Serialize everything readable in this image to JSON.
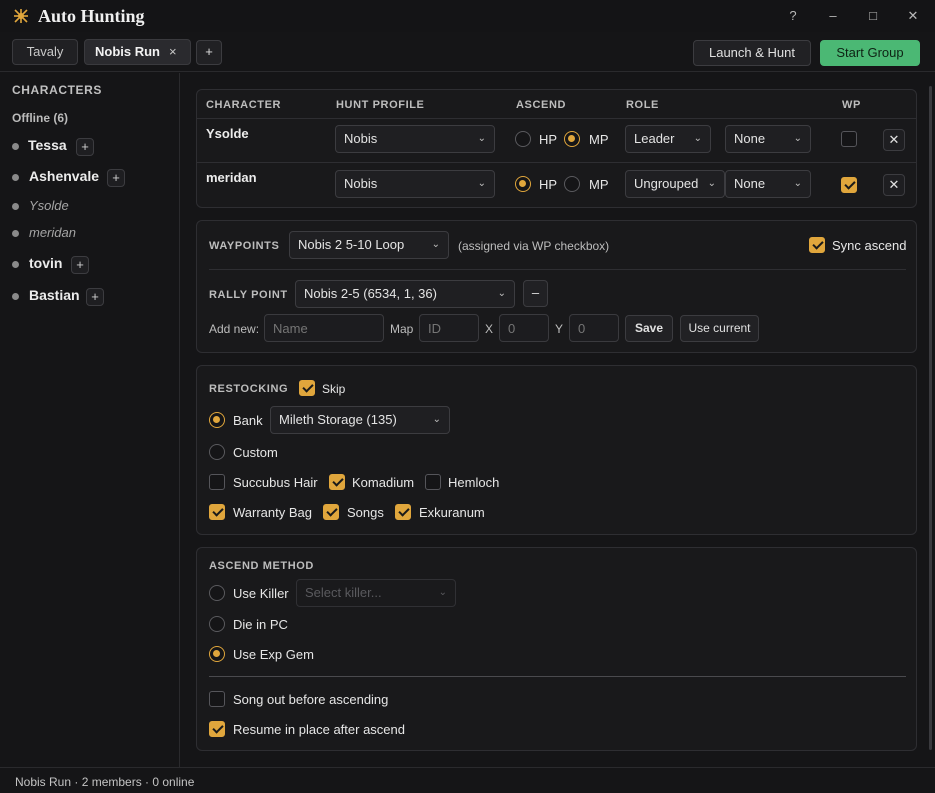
{
  "app": {
    "title": "Auto Hunting"
  },
  "window": {
    "help": "?",
    "minimize": "–",
    "maximize": "□",
    "close": "✕"
  },
  "tabs": [
    {
      "label": "Tavaly",
      "active": false
    },
    {
      "label": "Nobis Run",
      "active": true,
      "close": "×"
    }
  ],
  "tab_add": "+",
  "toolbar": {
    "launch_hunt": "Launch & Hunt",
    "start_group": "Start Group"
  },
  "sidebar": {
    "heading": "CHARACTERS",
    "offline_label": "Offline (6)",
    "characters": [
      {
        "name": "Tessa",
        "in_group": false
      },
      {
        "name": "Ashenvale",
        "in_group": false
      },
      {
        "name": "Ysolde",
        "in_group": true
      },
      {
        "name": "meridan",
        "in_group": true
      },
      {
        "name": "tovin",
        "in_group": false
      },
      {
        "name": "Bastian",
        "in_group": false
      }
    ],
    "add": "+"
  },
  "members": {
    "headers": {
      "character": "CHARACTER",
      "hunt_profile": "HUNT PROFILE",
      "ascend": "ASCEND",
      "role": "ROLE",
      "wp": "WP"
    },
    "ascend_options": [
      "HP",
      "MP"
    ],
    "rows": [
      {
        "name": "Ysolde",
        "profile": "Nobis",
        "ascend": "MP",
        "role": "Leader",
        "group": "None",
        "wp": false,
        "remove": "✕"
      },
      {
        "name": "meridan",
        "profile": "Nobis",
        "ascend": "HP",
        "role": "Ungrouped",
        "group": "None",
        "wp": true,
        "remove": "✕"
      }
    ]
  },
  "waypoints": {
    "label": "WAYPOINTS",
    "selected": "Nobis 2 5-10 Loop",
    "note": "(assigned via WP checkbox)",
    "sync_label": "Sync ascend",
    "sync_checked": true,
    "rally_label": "RALLY POINT",
    "rally_selected": "Nobis 2-5 (6534, 1, 36)",
    "rally_remove": "–",
    "add_new_label": "Add new:",
    "name_placeholder": "Name",
    "map_label": "Map",
    "id_placeholder": "ID",
    "x_label": "X",
    "x_placeholder": "0",
    "y_label": "Y",
    "y_placeholder": "0",
    "save": "Save",
    "use_current": "Use current"
  },
  "restocking": {
    "label": "RESTOCKING",
    "skip_label": "Skip",
    "skip_checked": true,
    "bank_label": "Bank",
    "bank_selected": true,
    "bank_location": "Mileth Storage (135)",
    "custom_label": "Custom",
    "items": [
      {
        "label": "Succubus Hair",
        "checked": false
      },
      {
        "label": "Komadium",
        "checked": true
      },
      {
        "label": "Hemloch",
        "checked": false
      },
      {
        "label": "Warranty Bag",
        "checked": true
      },
      {
        "label": "Songs",
        "checked": true
      },
      {
        "label": "Exkuranum",
        "checked": true
      }
    ]
  },
  "ascend_method": {
    "label": "ASCEND METHOD",
    "options": [
      {
        "label": "Use Killer",
        "selected": false
      },
      {
        "label": "Die in PC",
        "selected": false
      },
      {
        "label": "Use Exp Gem",
        "selected": true
      }
    ],
    "killer_placeholder": "Select killer...",
    "song_out_label": "Song out before ascending",
    "song_out_checked": false,
    "resume_label": "Resume in place after ascend",
    "resume_checked": true
  },
  "status": {
    "text": "Nobis Run · 2 members · 0 online"
  }
}
